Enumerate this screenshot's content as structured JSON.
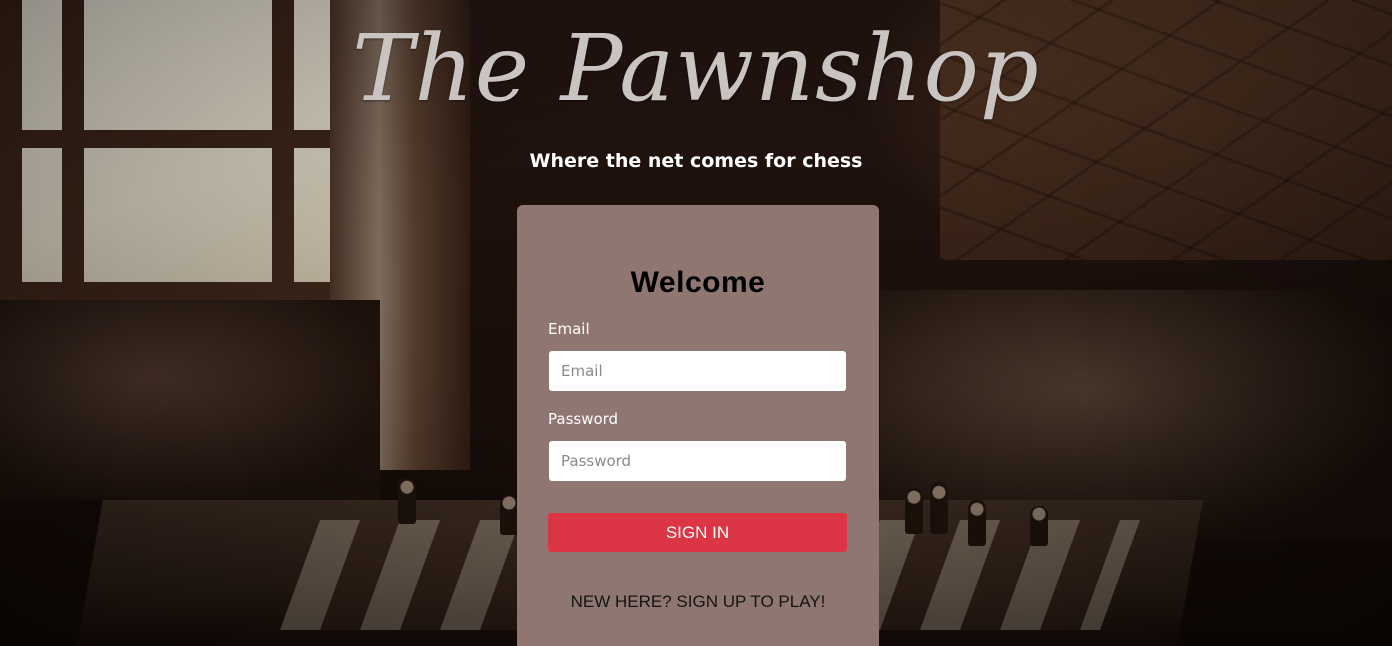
{
  "header": {
    "brand": "The Pawnshop",
    "tagline": "Where the net comes for chess"
  },
  "login": {
    "title": "Welcome",
    "email_label": "Email",
    "email_placeholder": "Email",
    "email_value": "",
    "password_label": "Password",
    "password_placeholder": "Password",
    "password_value": "",
    "submit_label": "SIGN IN",
    "signup_link": "NEW HERE? SIGN UP TO PLAY!"
  },
  "colors": {
    "card_background": "#8f7670",
    "submit_button": "#dc3545",
    "brand_text": "#c9c3c1"
  }
}
